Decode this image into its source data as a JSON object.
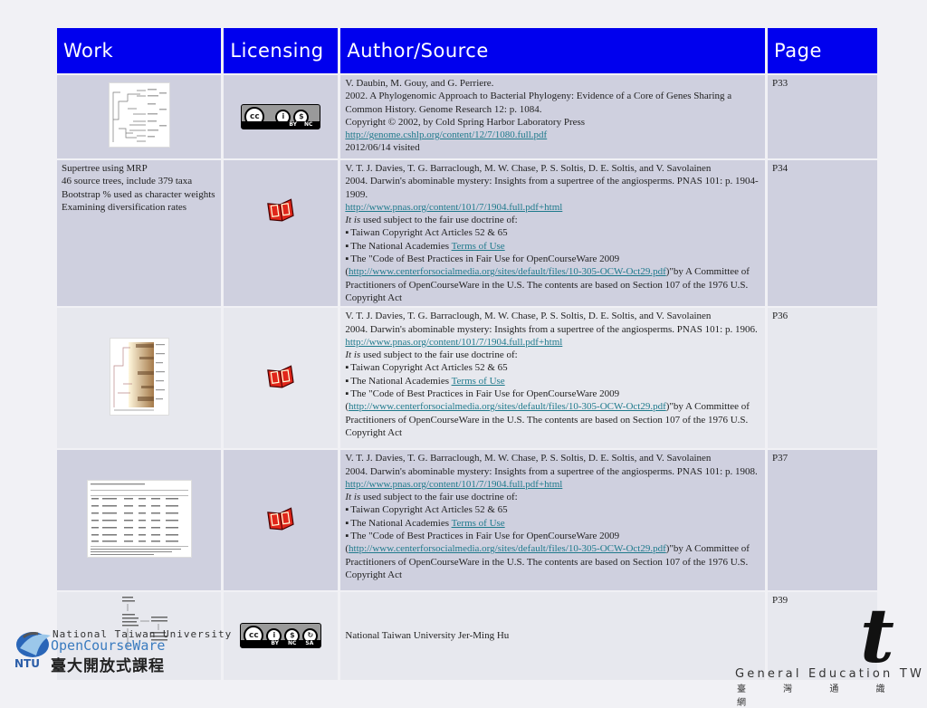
{
  "table": {
    "headers": [
      "Work",
      "Licensing",
      "Author/Source",
      "Page"
    ],
    "rows": [
      {
        "work_type": "image",
        "work_image": "phylogenomic-tree-figure",
        "license": "cc-by-nc",
        "license_labels": [
          "BY",
          "NC"
        ],
        "source_lines": [
          "V. Daubin, M. Gouy, and G. Perriere.",
          "2002. A Phylogenomic Approach to Bacterial Phylogeny: Evidence of a Core of Genes Sharing a Common History. Genome Research 12: p. 1084.",
          "Copyright © 2002, by Cold Spring Harbor Laboratory Press"
        ],
        "link": "http://genome.cshlp.org/content/12/7/1080.full.pdf",
        "visited": "2012/06/14 visited",
        "page": "P33"
      },
      {
        "work_type": "text",
        "work_lines": [
          "Supertree using MRP",
          "46 source trees, include 379 taxa",
          "Bootstrap % used as character weights",
          "Examining diversification rates"
        ],
        "license": "fair-use-book",
        "authors": "V. T. J. Davies, T. G. Barraclough, M. W. Chase, P. S. Soltis, D. E. Soltis, and V. Savolainen",
        "citation": "2004. Darwin's abominable mystery: Insights from a supertree of the angiosperms. PNAS 101: p. 1904-1909.",
        "link": "http://www.pnas.org/content/101/7/1904.full.pdf+html",
        "page": "P34"
      },
      {
        "work_type": "image",
        "work_image": "supertree-figure",
        "license": "fair-use-book",
        "authors": "V. T. J. Davies, T. G. Barraclough, M. W. Chase, P. S. Soltis, D. E. Soltis, and V. Savolainen",
        "citation": "2004. Darwin's abominable mystery: Insights from a supertree of the angiosperms. PNAS 101: p. 1906.",
        "link": "http://www.pnas.org/content/101/7/1904.full.pdf+html",
        "page": "P36"
      },
      {
        "work_type": "image",
        "work_image": "diversification-table-figure",
        "license": "fair-use-book",
        "authors": "V. T. J. Davies, T. G. Barraclough, M. W. Chase, P. S. Soltis, D. E. Soltis, and V. Savolainen",
        "citation": "2004. Darwin's abominable mystery: Insights from a supertree of the angiosperms. PNAS 101: p. 1908.",
        "link": "http://www.pnas.org/content/101/7/1904.full.pdf+html",
        "page": "P37"
      },
      {
        "work_type": "image",
        "work_image": "flowchart-figure",
        "license": "cc-by-nc-sa",
        "license_labels": [
          "BY",
          "NC",
          "SA"
        ],
        "source": "National Taiwan University Jer-Ming Hu",
        "page": "P39"
      }
    ],
    "fair_use": {
      "intro_italic": "It is",
      "intro_rest": " used subject to the fair use doctrine of:",
      "bullet1": "Taiwan Copyright Act Articles 52 & 65",
      "bullet2_prefix": "The National Academies ",
      "bullet2_link": "Terms of Use",
      "bullet3_prefix": "The \"Code of Best Practices in Fair Use for OpenCourseWare 2009 (",
      "bullet3_link": "http://www.centerforsocialmedia.org/sites/default/files/10-305-OCW-Oct29.pdf",
      "bullet3_suffix": ")\"by A Committee of Practitioners of OpenCourseWare in the U.S. The contents are based on Section 107 of the 1976 U.S. Copyright Act",
      "bullet_glyph": "▪"
    }
  },
  "footer": {
    "ntu_line1": "National Taiwan University",
    "ntu_line2": "OpenCourseWare",
    "ntu_line3": "臺大開放式課程",
    "ntu_badge": "NTU",
    "ge_logo": "t",
    "ge_line1": "General Education TW",
    "ge_line2": "臺 灣 通 識 網"
  }
}
